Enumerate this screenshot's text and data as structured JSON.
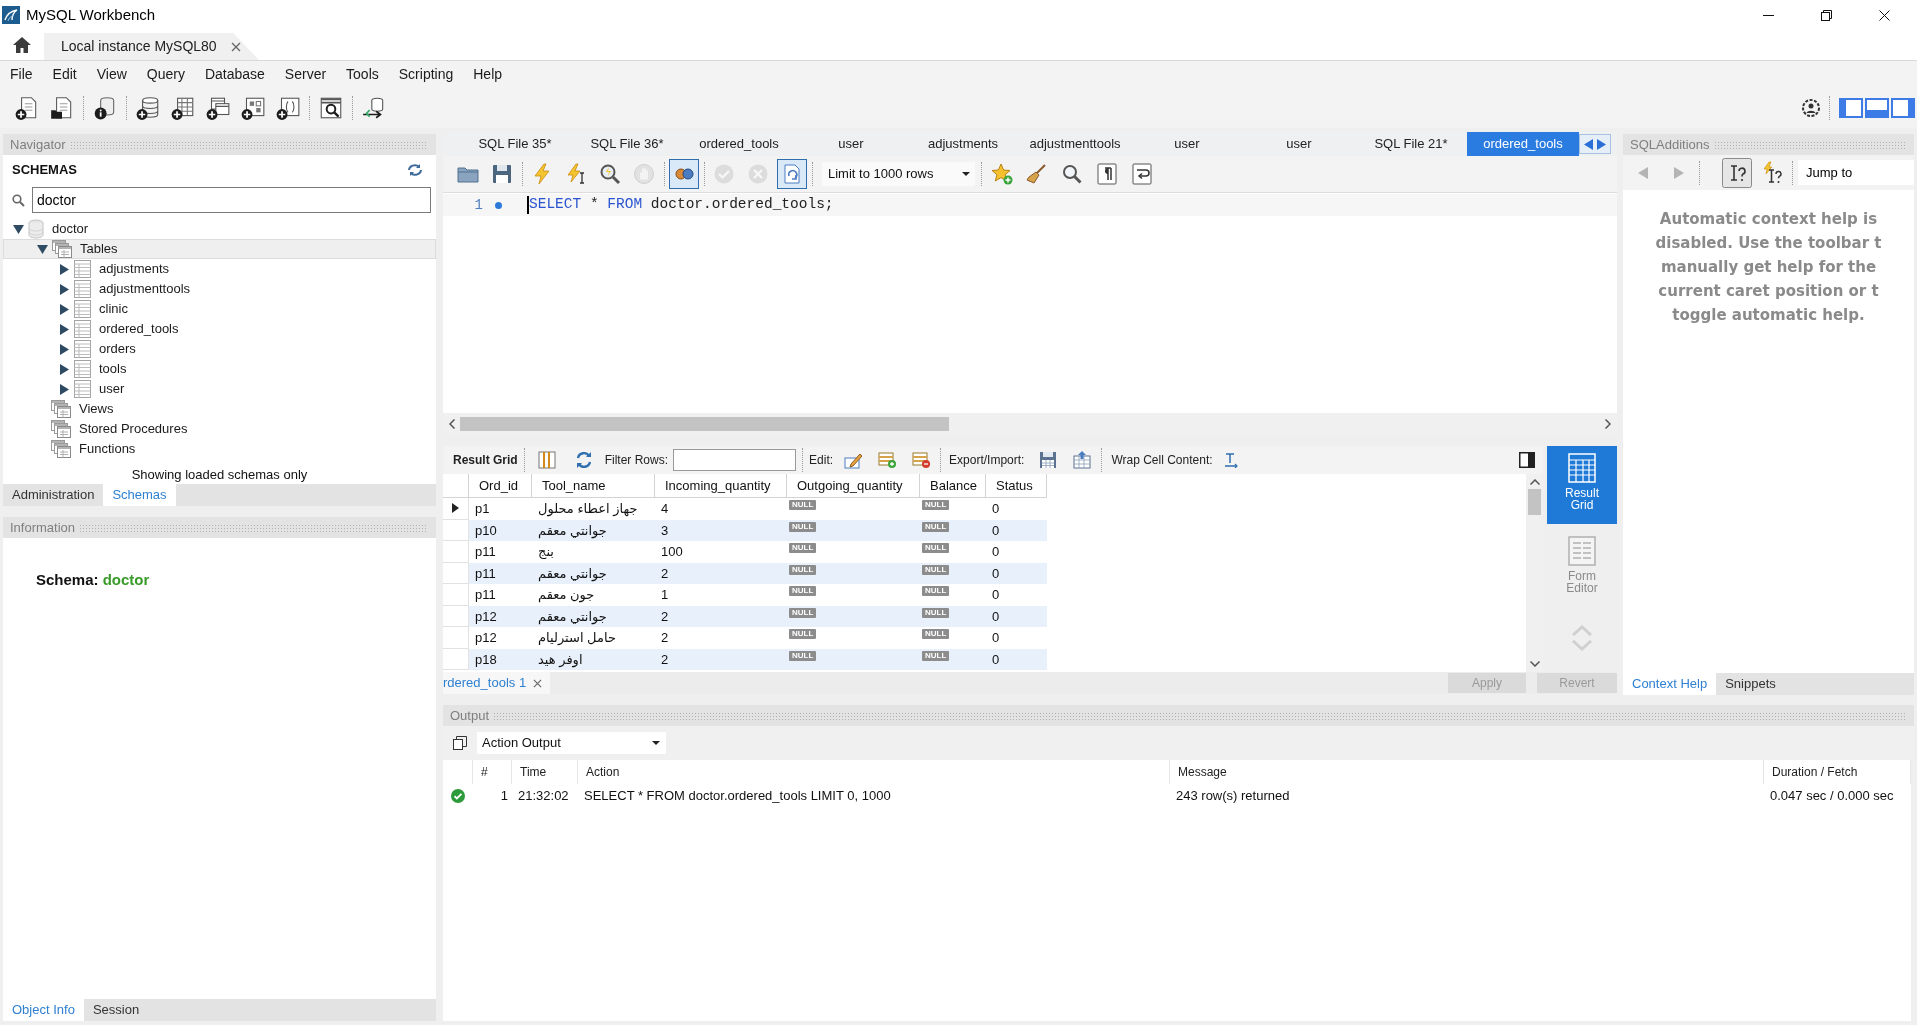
{
  "window": {
    "title": "MySQL Workbench"
  },
  "connection_tabs": [
    {
      "label": "Local instance MySQL80",
      "selected": true
    }
  ],
  "menu": [
    "File",
    "Edit",
    "View",
    "Query",
    "Database",
    "Server",
    "Tools",
    "Scripting",
    "Help"
  ],
  "panel_toggles": [
    {
      "on": true
    },
    {
      "on": true
    },
    {
      "on": true
    }
  ],
  "navigator": {
    "title": "Navigator",
    "heading": "SCHEMAS",
    "search": {
      "value": "doctor"
    },
    "tree": [
      {
        "label": "doctor",
        "kind": "schema",
        "expanded": true,
        "selected": false,
        "children": [
          {
            "label": "Tables",
            "kind": "folder",
            "expanded": true,
            "selected": true,
            "children": [
              {
                "label": "adjustments",
                "kind": "table",
                "expanded": false,
                "selected": false
              },
              {
                "label": "adjustmenttools",
                "kind": "table",
                "expanded": false,
                "selected": false
              },
              {
                "label": "clinic",
                "kind": "table",
                "expanded": false,
                "selected": false
              },
              {
                "label": "ordered_tools",
                "kind": "table",
                "expanded": false,
                "selected": false
              },
              {
                "label": "orders",
                "kind": "table",
                "expanded": false,
                "selected": false
              },
              {
                "label": "tools",
                "kind": "table",
                "expanded": false,
                "selected": false
              },
              {
                "label": "user",
                "kind": "table",
                "expanded": false,
                "selected": false
              }
            ]
          },
          {
            "label": "Views",
            "kind": "folder",
            "selected": false
          },
          {
            "label": "Stored Procedures",
            "kind": "folder",
            "selected": false
          },
          {
            "label": "Functions",
            "kind": "folder",
            "selected": false
          }
        ]
      }
    ],
    "note": "Showing loaded schemas only",
    "tabs": [
      {
        "label": "Administration",
        "selected": false
      },
      {
        "label": "Schemas",
        "selected": true
      }
    ]
  },
  "information": {
    "title": "Information",
    "schema_label": "Schema:",
    "schema_name": "doctor",
    "tabs": [
      {
        "label": "Object Info",
        "selected": true
      },
      {
        "label": "Session",
        "selected": false
      }
    ]
  },
  "editor": {
    "tabs": [
      {
        "label": "SQL File 35*",
        "selected": false
      },
      {
        "label": "SQL File 36*",
        "selected": false
      },
      {
        "label": "ordered_tools",
        "selected": false
      },
      {
        "label": "user",
        "selected": false
      },
      {
        "label": "adjustments",
        "selected": false
      },
      {
        "label": "adjustmenttools",
        "selected": false
      },
      {
        "label": "user",
        "selected": false
      },
      {
        "label": "user",
        "selected": false
      },
      {
        "label": "SQL File 21*",
        "selected": false
      },
      {
        "label": "ordered_tools",
        "selected": true
      }
    ],
    "toolbar": [
      {
        "on": false,
        "disabled": false
      },
      {
        "on": false,
        "disabled": false
      },
      {
        "on": false,
        "disabled": false
      },
      {
        "on": false,
        "disabled": false
      },
      {
        "on": false,
        "disabled": false
      },
      {
        "on": false,
        "disabled": true
      },
      {
        "on": true,
        "disabled": false
      },
      {
        "on": false,
        "disabled": true
      },
      {
        "on": false,
        "disabled": true
      },
      {
        "on": true,
        "disabled": false
      },
      {
        "on": false,
        "disabled": false
      },
      {
        "on": false,
        "disabled": false
      },
      {
        "on": false,
        "disabled": false
      },
      {
        "on": false,
        "disabled": false
      },
      {
        "on": false,
        "disabled": false
      }
    ],
    "limit": "Limit to 1000 rows",
    "lines": [
      {
        "number": "1",
        "tokens": [
          {
            "text": "SELECT",
            "kind": "keyword"
          },
          {
            "text": " * ",
            "kind": "plain"
          },
          {
            "text": "FROM",
            "kind": "keyword"
          },
          {
            "text": " doctor.ordered_tools;",
            "kind": "plain"
          }
        ]
      }
    ]
  },
  "result": {
    "toolbar_title": "Result Grid",
    "filter_label": "Filter Rows:",
    "edit_label": "Edit:",
    "export_label": "Export/Import:",
    "wrap_label": "Wrap Cell Content:",
    "columns": [
      "Ord_id",
      "Tool_name",
      "Incoming_quantity",
      "Outgoing_quantity",
      "Balance",
      "Status"
    ],
    "rows": [
      {
        "current": true,
        "cells": [
          {
            "text": "p1",
            "kind": "value"
          },
          {
            "text": "جهاز اعطاء محلول",
            "kind": "value"
          },
          {
            "text": "4",
            "kind": "value"
          },
          {
            "text": "NULL",
            "kind": "null"
          },
          {
            "text": "NULL",
            "kind": "null"
          },
          {
            "text": "0",
            "kind": "value"
          }
        ]
      },
      {
        "current": false,
        "cells": [
          {
            "text": "p10",
            "kind": "value"
          },
          {
            "text": "جوانتي معقم",
            "kind": "value"
          },
          {
            "text": "3",
            "kind": "value"
          },
          {
            "text": "NULL",
            "kind": "null"
          },
          {
            "text": "NULL",
            "kind": "null"
          },
          {
            "text": "0",
            "kind": "value"
          }
        ]
      },
      {
        "current": false,
        "cells": [
          {
            "text": "p11",
            "kind": "value"
          },
          {
            "text": "بنج",
            "kind": "value"
          },
          {
            "text": "100",
            "kind": "value"
          },
          {
            "text": "NULL",
            "kind": "null"
          },
          {
            "text": "NULL",
            "kind": "null"
          },
          {
            "text": "0",
            "kind": "value"
          }
        ]
      },
      {
        "current": false,
        "cells": [
          {
            "text": "p11",
            "kind": "value"
          },
          {
            "text": "جوانتي معقم",
            "kind": "value"
          },
          {
            "text": "2",
            "kind": "value"
          },
          {
            "text": "NULL",
            "kind": "null"
          },
          {
            "text": "NULL",
            "kind": "null"
          },
          {
            "text": "0",
            "kind": "value"
          }
        ]
      },
      {
        "current": false,
        "cells": [
          {
            "text": "p11",
            "kind": "value"
          },
          {
            "text": "جون معقم",
            "kind": "value"
          },
          {
            "text": "1",
            "kind": "value"
          },
          {
            "text": "NULL",
            "kind": "null"
          },
          {
            "text": "NULL",
            "kind": "null"
          },
          {
            "text": "0",
            "kind": "value"
          }
        ]
      },
      {
        "current": false,
        "cells": [
          {
            "text": "p12",
            "kind": "value"
          },
          {
            "text": "جوانتي معقم",
            "kind": "value"
          },
          {
            "text": "2",
            "kind": "value"
          },
          {
            "text": "NULL",
            "kind": "null"
          },
          {
            "text": "NULL",
            "kind": "null"
          },
          {
            "text": "0",
            "kind": "value"
          }
        ]
      },
      {
        "current": false,
        "cells": [
          {
            "text": "p12",
            "kind": "value"
          },
          {
            "text": "حامل استرليام",
            "kind": "value"
          },
          {
            "text": "2",
            "kind": "value"
          },
          {
            "text": "NULL",
            "kind": "null"
          },
          {
            "text": "NULL",
            "kind": "null"
          },
          {
            "text": "0",
            "kind": "value"
          }
        ]
      },
      {
        "current": false,
        "cells": [
          {
            "text": "p18",
            "kind": "value"
          },
          {
            "text": "اوفر هيد",
            "kind": "value"
          },
          {
            "text": "2",
            "kind": "value"
          },
          {
            "text": "NULL",
            "kind": "null"
          },
          {
            "text": "NULL",
            "kind": "null"
          },
          {
            "text": "0",
            "kind": "value"
          }
        ]
      }
    ],
    "views": [
      {
        "label": "Result Grid",
        "selected": true
      },
      {
        "label": "Form Editor",
        "selected": false
      }
    ],
    "tabs": [
      {
        "label": "rdered_tools 1",
        "selected": true
      }
    ],
    "buttons": [
      {
        "label": "Apply",
        "disabled": true
      },
      {
        "label": "Revert",
        "disabled": true
      }
    ]
  },
  "sql_additions": {
    "title": "SQLAdditions",
    "toolbar": [
      {
        "on": false,
        "disabled": true
      },
      {
        "on": false,
        "disabled": true
      },
      {
        "on": true,
        "disabled": false
      },
      {
        "on": false,
        "disabled": false
      }
    ],
    "jump_to": "Jump to",
    "help": [
      "Automatic context help is",
      "disabled. Use the toolbar t",
      "manually get help for the",
      "current caret position or t",
      "toggle automatic help."
    ],
    "tabs": [
      {
        "label": "Context Help",
        "selected": true
      },
      {
        "label": "Snippets",
        "selected": false
      }
    ]
  },
  "output": {
    "title": "Output",
    "mode": "Action Output",
    "columns": [
      "#",
      "Time",
      "Action",
      "Message",
      "Duration / Fetch"
    ],
    "rows": [
      {
        "success": true,
        "number": "1",
        "time": "21:32:02",
        "action": "SELECT * FROM doctor.ordered_tools LIMIT 0, 1000",
        "message": "243 row(s) returned",
        "duration": "0.047 sec / 0.000 sec"
      }
    ]
  }
}
